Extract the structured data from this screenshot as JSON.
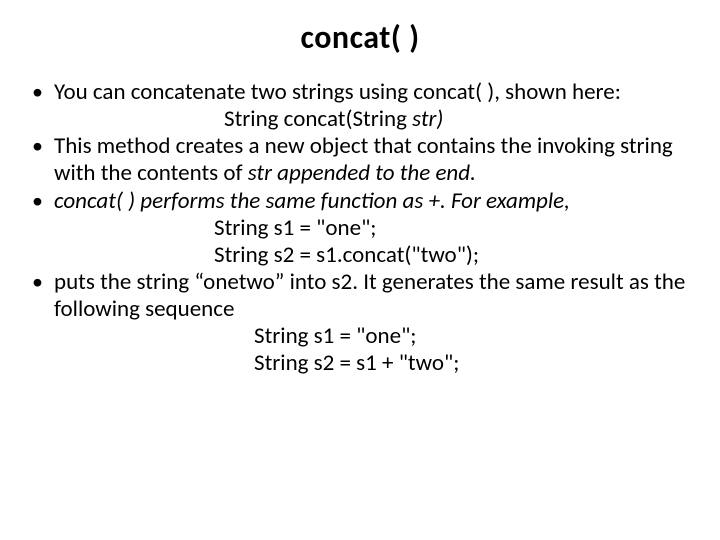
{
  "title": "concat( )",
  "bullets": [
    {
      "text": "You can concatenate two strings using concat( ), shown here:",
      "sub": [
        {
          "text": "String concat(String str)",
          "italic_tail": "str)",
          "indent": "indent1",
          "composed": true
        }
      ]
    },
    {
      "text_parts": {
        "a": "This method creates a new object that contains the invoking string with the contents of ",
        "b": "str appended to the end."
      }
    },
    {
      "italic_full": "concat( ) performs the same function as +. For example,",
      "sub": [
        {
          "text": "String s1 = \"one\";",
          "indent": "indent2"
        },
        {
          "text": "String s2 = s1.concat(\"two\");",
          "indent": "indent2"
        }
      ]
    },
    {
      "text": "puts the string “onetwo” into s2. It generates the same result as the following sequence",
      "sub": [
        {
          "text": "String s1 = \"one\";",
          "indent": "indent3"
        },
        {
          "text": "String s2 = s1 + \"two\";",
          "indent": "indent3"
        }
      ]
    }
  ]
}
